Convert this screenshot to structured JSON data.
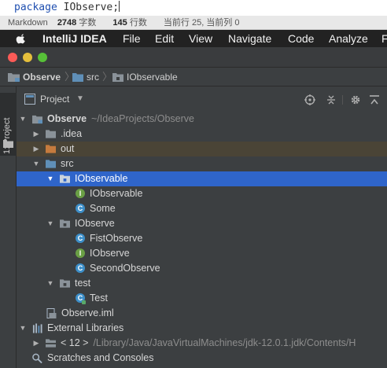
{
  "editor": {
    "code_line": "package",
    "code_ident": "IObserve;"
  },
  "status_bar": {
    "mode": "Markdown",
    "words_value": "2748",
    "words_unit": "字数",
    "lines_value": "145",
    "lines_unit": "行数",
    "cursor": "当前行 25, 当前列 0"
  },
  "menubar": {
    "app_name": "IntelliJ IDEA",
    "items": [
      "File",
      "Edit",
      "View",
      "Navigate",
      "Code",
      "Analyze",
      "F"
    ]
  },
  "navbar": {
    "crumbs": [
      "Observe",
      "src",
      "IObservable"
    ]
  },
  "side_tab": {
    "label": "1: Project"
  },
  "project_panel": {
    "title": "Project",
    "tree": [
      {
        "label": "Observe",
        "suffix": "~/IdeaProjects/Observe"
      },
      {
        "label": ".idea"
      },
      {
        "label": "out"
      },
      {
        "label": "src"
      },
      {
        "label": "IObservable"
      },
      {
        "label": "IObservable"
      },
      {
        "label": "Some"
      },
      {
        "label": "IObserve"
      },
      {
        "label": "FistObserve"
      },
      {
        "label": "IObserve"
      },
      {
        "label": "SecondObserve"
      },
      {
        "label": "test"
      },
      {
        "label": "Test"
      },
      {
        "label": "Observe.iml"
      },
      {
        "label": "External Libraries"
      },
      {
        "label": "< 12 >",
        "suffix": "/Library/Java/JavaVirtualMachines/jdk-12.0.1.jdk/Contents/H"
      },
      {
        "label": "Scratches and Consoles"
      }
    ]
  },
  "colors": {
    "selection": "#2f65ca",
    "excluded_row": "#4a4436",
    "class_icon": "#3d8fc9",
    "interface_icon": "#6a9f45",
    "folder_blue": "#5f8fb8",
    "folder_orange": "#c57b3e"
  }
}
